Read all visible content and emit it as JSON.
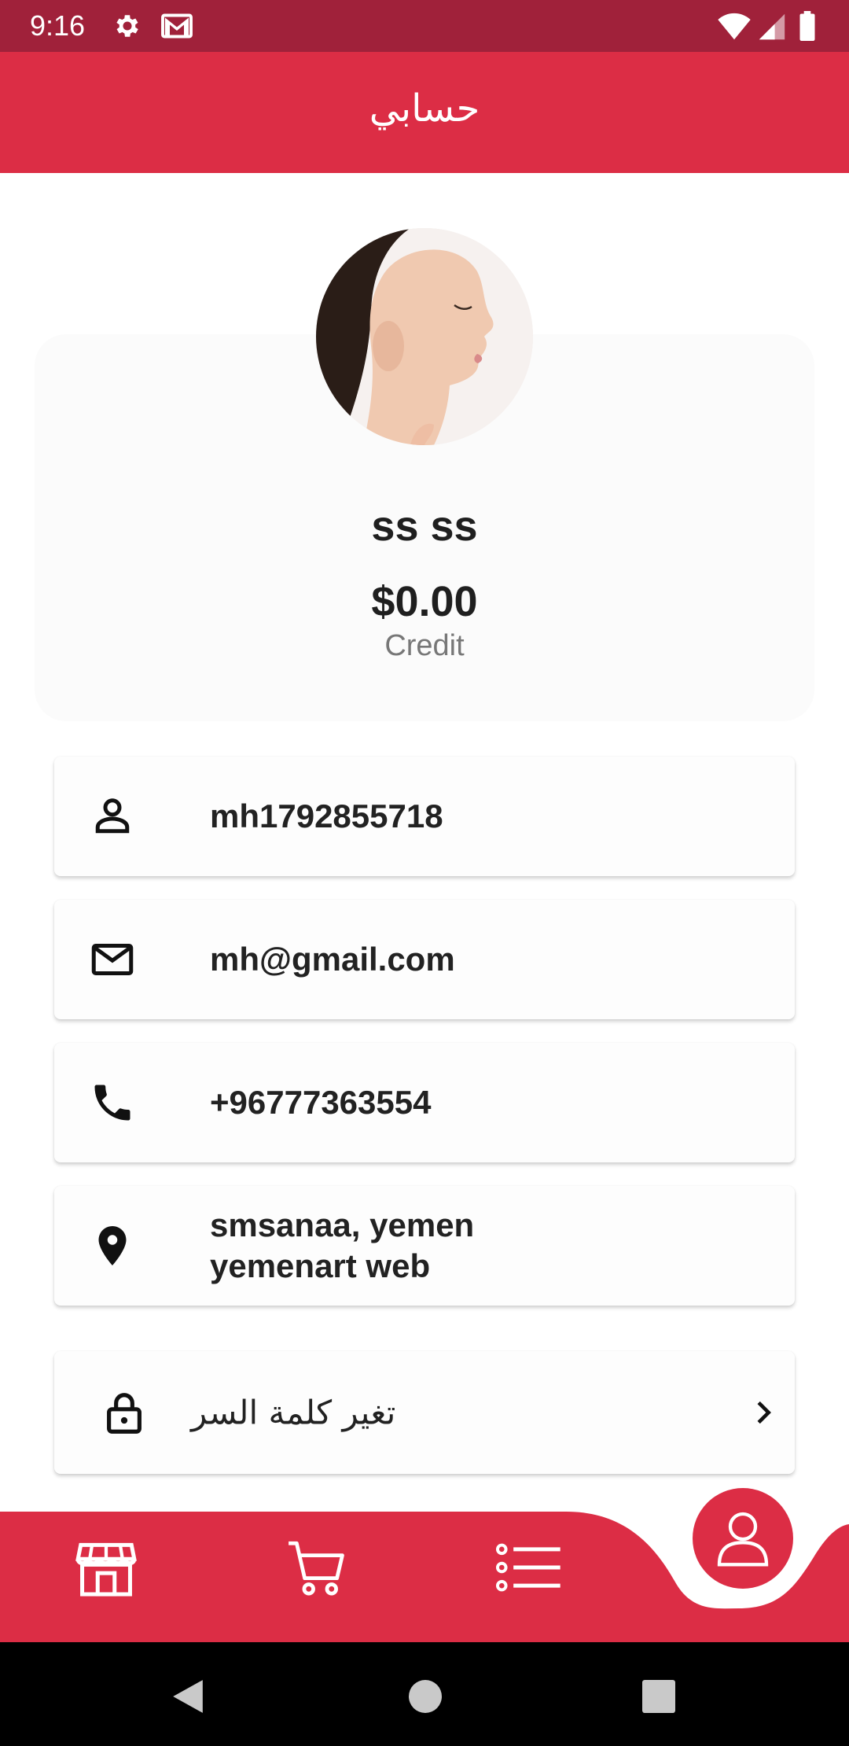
{
  "status_bar": {
    "time": "9:16",
    "icons": [
      "gear-icon",
      "gmail-icon",
      "wifi-icon",
      "signal-icon",
      "battery-icon"
    ]
  },
  "app_bar": {
    "title": "حسابي"
  },
  "profile": {
    "name": "ss ss",
    "credit_amount": "$0.00",
    "credit_label": "Credit"
  },
  "info": {
    "username": "mh1792855718",
    "email": "mh@gmail.com",
    "phone": "+96777363554",
    "address_line1": "smsanaa, yemen",
    "address_line2": "yemenart web"
  },
  "password_row": {
    "label": "تغير كلمة السر"
  },
  "bottom_nav": {
    "items": [
      "store-icon",
      "cart-icon",
      "list-icon",
      "profile-icon"
    ],
    "active": "profile-icon"
  },
  "colors": {
    "primary": "#dc2d45",
    "status_bar": "#a0213a"
  }
}
